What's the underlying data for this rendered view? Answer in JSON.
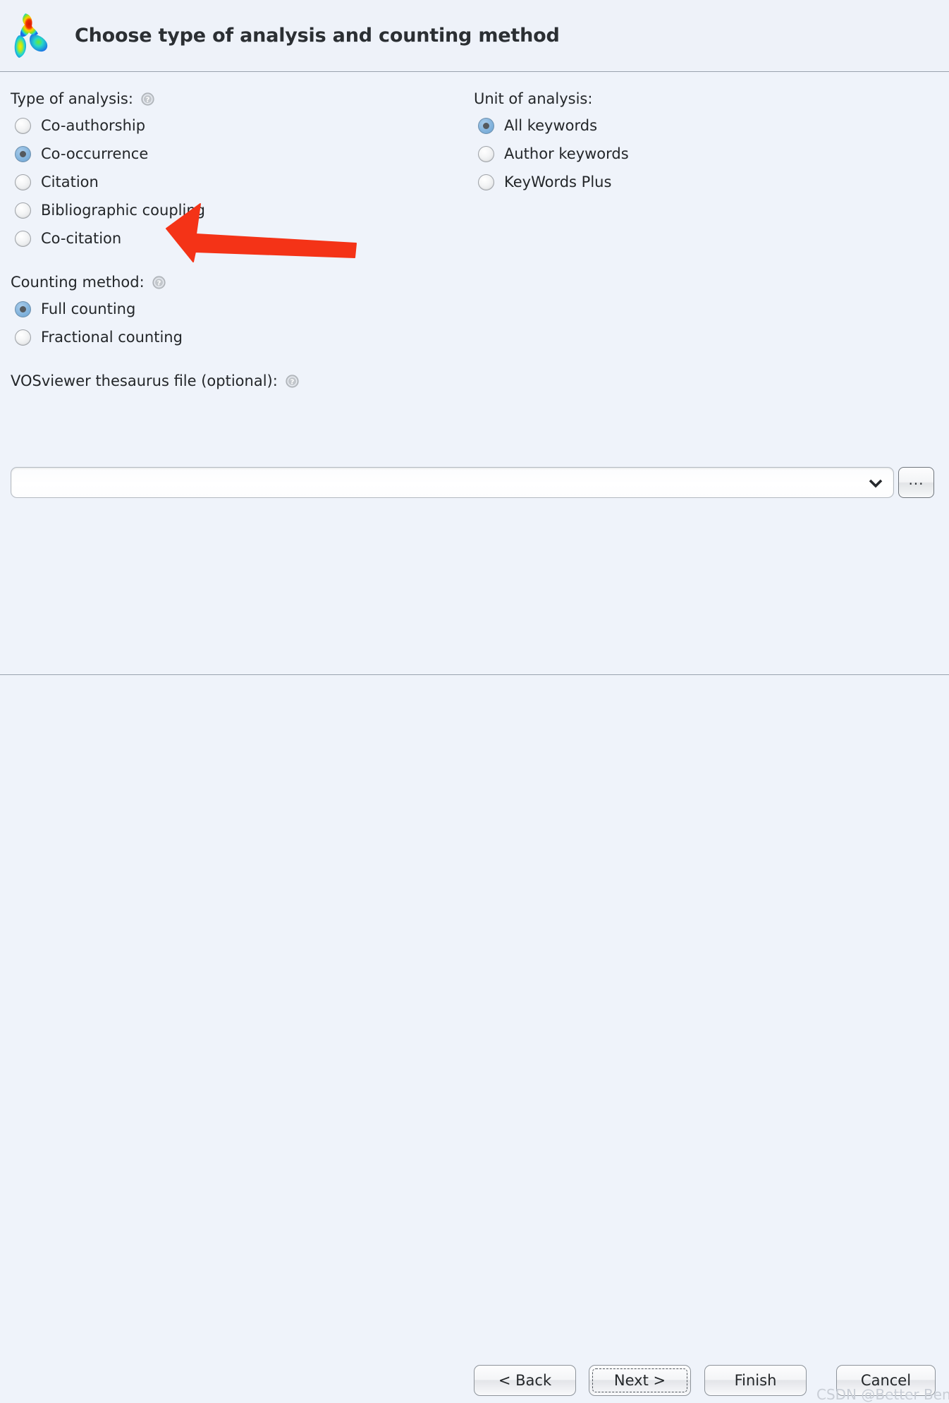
{
  "window": {
    "title": "Choose type of analysis and counting method",
    "logo_icon": "vosviewer-heatmap-logo"
  },
  "type_of_analysis": {
    "label": "Type of analysis:",
    "help_icon": "help-question-icon",
    "options": [
      {
        "label": "Co-authorship",
        "selected": false
      },
      {
        "label": "Co-occurrence",
        "selected": true
      },
      {
        "label": "Citation",
        "selected": false
      },
      {
        "label": "Bibliographic coupling",
        "selected": false
      },
      {
        "label": "Co-citation",
        "selected": false
      }
    ]
  },
  "unit_of_analysis": {
    "label": "Unit of analysis:",
    "options": [
      {
        "label": "All keywords",
        "selected": true
      },
      {
        "label": "Author keywords",
        "selected": false
      },
      {
        "label": "KeyWords Plus",
        "selected": false
      }
    ]
  },
  "counting_method": {
    "label": "Counting method:",
    "help_icon": "help-question-icon",
    "options": [
      {
        "label": "Full counting",
        "selected": true
      },
      {
        "label": "Fractional counting",
        "selected": false
      }
    ]
  },
  "thesaurus": {
    "label": "VOSviewer thesaurus file (optional):",
    "help_icon": "help-question-icon",
    "value": "",
    "placeholder": "",
    "dropdown_icon": "chevron-down-icon",
    "browse_label": "...",
    "browse_icon": "ellipsis-icon"
  },
  "footer": {
    "back_label": "< Back",
    "next_label": "Next >",
    "finish_label": "Finish",
    "cancel_label": "Cancel"
  },
  "annotation": {
    "arrow_icon": "red-left-arrow-annotation",
    "color": "#f43317"
  },
  "watermark": {
    "text": "CSDN @Better Bench"
  },
  "colors": {
    "background": "#eff3fa",
    "divider": "#9aa2ae",
    "text": "#232629",
    "radio_selected": "#84b4dd",
    "annotation_red": "#f43317",
    "watermark_gray": "#c9ced6"
  }
}
